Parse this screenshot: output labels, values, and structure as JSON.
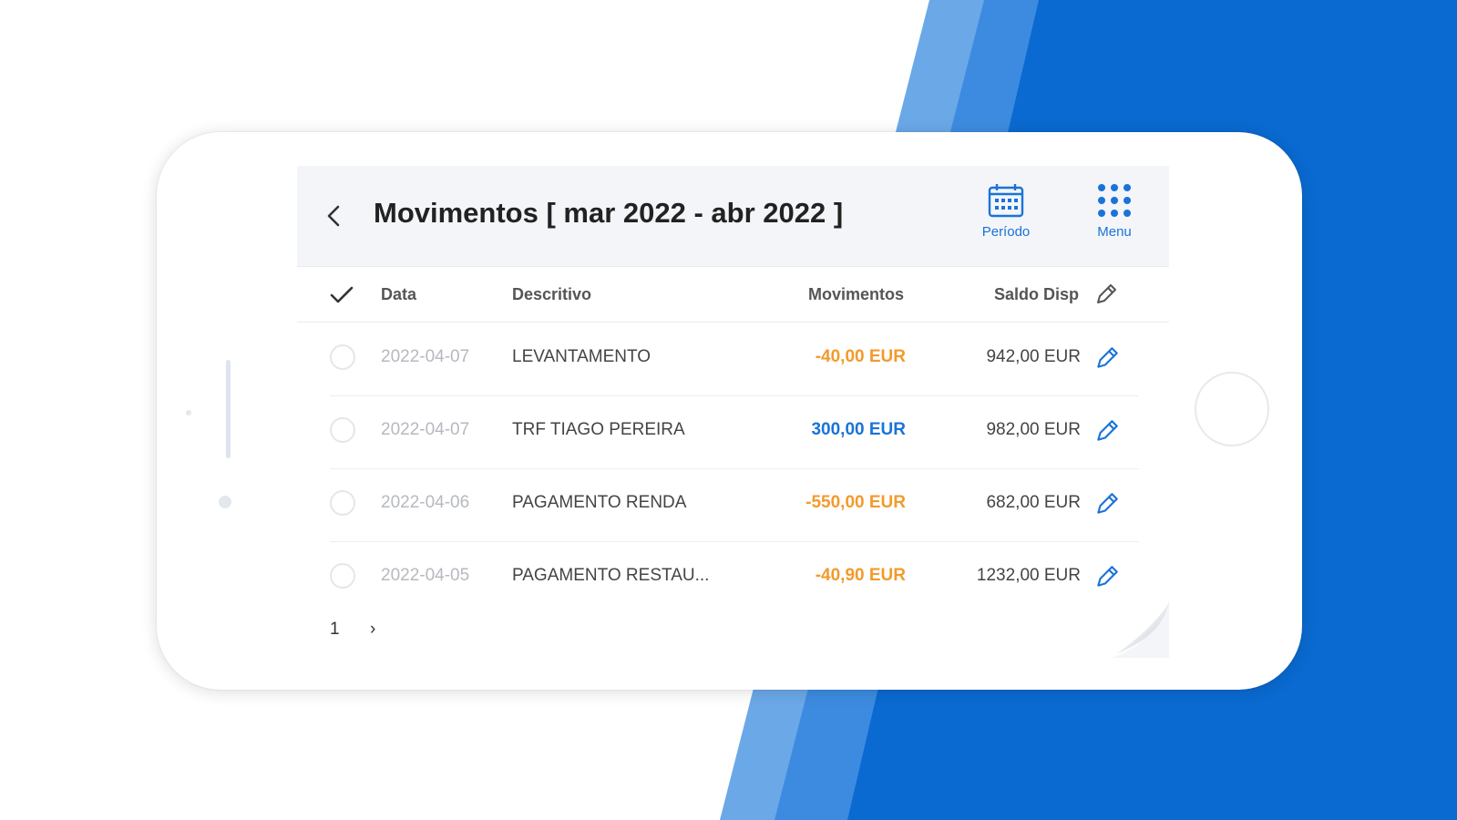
{
  "colors": {
    "brand_blue": "#0a6ad1",
    "light_blue": "#6ba8e8",
    "header_bg": "#f3f5f9",
    "accent_link": "#1a73d8",
    "negative_amount": "#f39a2c",
    "positive_amount": "#1a73d8"
  },
  "header": {
    "back_icon": "chevron-left-icon",
    "title": "Movimentos [ mar 2022 - abr 2022 ]",
    "periodo_label": "Período",
    "periodo_icon": "calendar-icon",
    "menu_label": "Menu",
    "menu_icon": "grid-icon"
  },
  "table": {
    "headers": {
      "select": "check-icon",
      "data": "Data",
      "descritivo": "Descritivo",
      "movimentos": "Movimentos",
      "saldo": "Saldo Disp",
      "edit": "pencil-icon"
    },
    "rows": [
      {
        "data": "2022-04-07",
        "descritivo": "LEVANTAMENTO",
        "movimento": "-40,00 EUR",
        "tipo": "negative",
        "saldo": "942,00 EUR"
      },
      {
        "data": "2022-04-07",
        "descritivo": "TRF TIAGO PEREIRA",
        "movimento": "300,00 EUR",
        "tipo": "positive",
        "saldo": "982,00 EUR"
      },
      {
        "data": "2022-04-06",
        "descritivo": "PAGAMENTO RENDA",
        "movimento": "-550,00 EUR",
        "tipo": "negative",
        "saldo": "682,00 EUR"
      },
      {
        "data": "2022-04-05",
        "descritivo": "PAGAMENTO RESTAU...",
        "movimento": "-40,90 EUR",
        "tipo": "negative",
        "saldo": "1232,00 EUR"
      }
    ]
  },
  "pagination": {
    "current_page": "1",
    "next_label": "›"
  }
}
